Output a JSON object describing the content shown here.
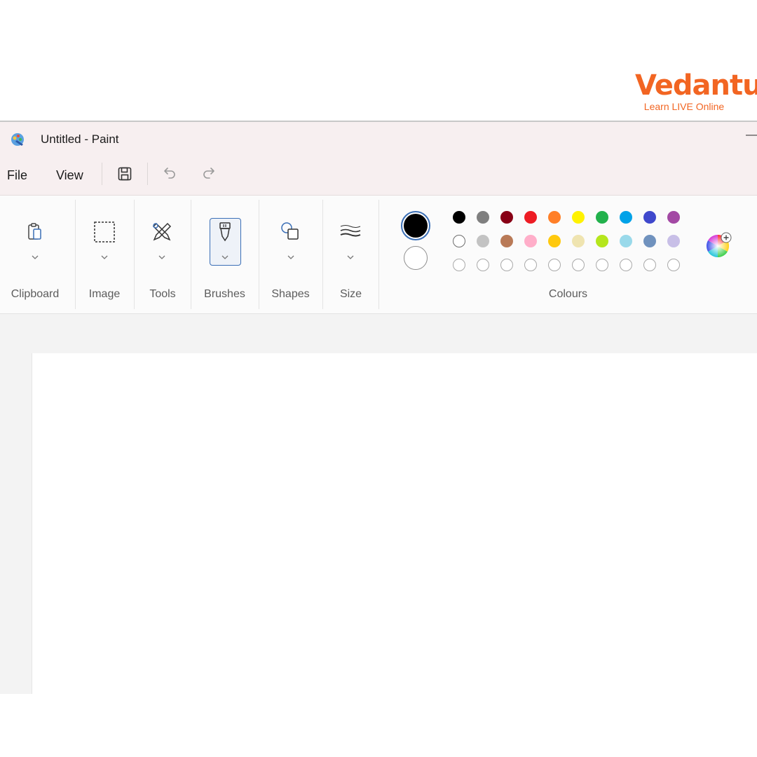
{
  "brand": {
    "logo": "Vedantu",
    "tagline": "Learn LIVE Online"
  },
  "window": {
    "title": "Untitled - Paint",
    "menu": {
      "file": "File",
      "view": "View"
    },
    "quick_access": [
      "save-icon",
      "undo-icon",
      "redo-icon"
    ]
  },
  "ribbon": {
    "groups": {
      "clipboard": "Clipboard",
      "image": "Image",
      "tools": "Tools",
      "brushes": "Brushes",
      "shapes": "Shapes",
      "size": "Size",
      "colours": "Colours"
    },
    "colours": {
      "primary": "#000000",
      "secondary": "#ffffff",
      "palette_row1": [
        "#000000",
        "#7f7f7f",
        "#880015",
        "#ed1c24",
        "#ff7f27",
        "#fff200",
        "#22b14c",
        "#00a2e8",
        "#3f48cc",
        "#a349a4"
      ],
      "palette_row2": [
        "#ffffff",
        "#c3c3c3",
        "#b97a57",
        "#ffaec9",
        "#ffc90e",
        "#efe4b0",
        "#b5e61d",
        "#99d9ea",
        "#7092be",
        "#c8bfe7"
      ],
      "custom_slots": 10
    }
  },
  "colors": {
    "accent": "#3b6fb6",
    "brand": "#f26522",
    "titlebar": "#f7eff0"
  }
}
